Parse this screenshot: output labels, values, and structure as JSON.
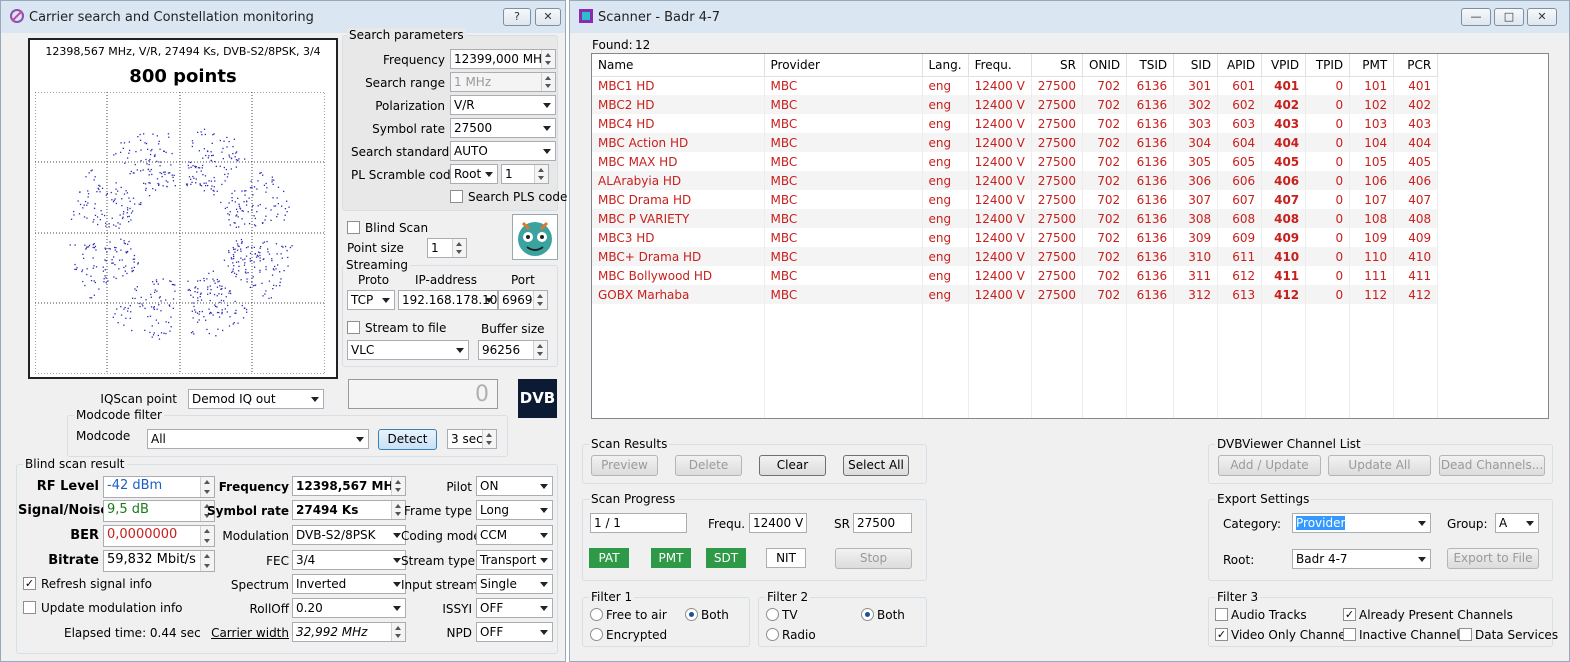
{
  "left": {
    "title": "Carrier search and Constellation monitoring",
    "help_btn": "?",
    "close_btn": "✕",
    "constellation": {
      "info": "12398,567 MHz, V/R, 27494 Ks, DVB-S2/8PSK, 3/4",
      "points_label": "800 points"
    },
    "search_params": {
      "title": "Search parameters",
      "frequency_label": "Frequency",
      "frequency": "12399,000 MHz",
      "search_range_label": "Search range",
      "search_range": "1 MHz",
      "polarization_label": "Polarization",
      "polarization": "V/R",
      "symbol_rate_label": "Symbol rate",
      "symbol_rate": "27500",
      "search_standard_label": "Search standard",
      "search_standard": "AUTO",
      "pl_scramble_label": "PL Scramble code",
      "pl_scramble_mode": "Root",
      "pl_scramble_value": "1",
      "search_pls_label": "Search PLS code"
    },
    "blind_scan_label": "Blind Scan",
    "point_size_label": "Point size",
    "point_size": "1",
    "streaming": {
      "title": "Streaming",
      "proto_label": "Proto",
      "ip_label": "IP-address",
      "port_label": "Port",
      "proto": "TCP",
      "ip": "192.168.178.10",
      "port": "6969",
      "stream_to_file_label": "Stream to file",
      "buffer_size_label": "Buffer size",
      "player": "VLC",
      "buffer_size": "96256"
    },
    "iqscan_label": "IQScan point",
    "iqscan": "Demod IQ out",
    "counter": "0",
    "dvb_logo": "DVB",
    "modcode_filter": {
      "title": "Modcode filter",
      "modcode_label": "Modcode",
      "modcode": "All",
      "detect_btn": "Detect",
      "interval": "3 sec"
    },
    "blind_result": {
      "title": "Blind scan result",
      "rf_level_label": "RF Level",
      "rf_level": "-42 dBm",
      "snr_label": "Signal/Noise",
      "snr": "9,5 dB",
      "ber_label": "BER",
      "ber": "0,0000000",
      "bitrate_label": "Bitrate",
      "bitrate": "59,832 Mbit/s",
      "refresh_label": "Refresh signal info",
      "update_mod_label": "Update modulation info",
      "elapsed": "Elapsed time: 0.44 sec",
      "frequency_label": "Frequency",
      "frequency": "12398,567 MHz",
      "symbol_rate_label": "Symbol rate",
      "symbol_rate": "27494 Ks",
      "modulation_label": "Modulation",
      "modulation": "DVB-S2/8PSK",
      "fec_label": "FEC",
      "fec": "3/4",
      "spectrum_label": "Spectrum",
      "spectrum": "Inverted",
      "rolloff_label": "RollOff",
      "rolloff": "0.20",
      "carrier_width_label": "Carrier width",
      "carrier_width": "32,992 MHz",
      "pilot_label": "Pilot",
      "pilot": "ON",
      "frame_type_label": "Frame type",
      "frame_type": "Long",
      "coding_mode_label": "Coding mode",
      "coding_mode": "CCM",
      "stream_type_label": "Stream type",
      "stream_type": "Transport",
      "input_stream_label": "Input stream",
      "input_stream": "Single",
      "issyi_label": "ISSYI",
      "issyi": "OFF",
      "npd_label": "NPD",
      "npd": "OFF"
    }
  },
  "right": {
    "title": "Scanner - Badr 4-7",
    "found_label": "Found:",
    "found": "12",
    "columns": [
      "Name",
      "Provider",
      "Lang.",
      "Frequ.",
      "SR",
      "ONID",
      "TSID",
      "SID",
      "APID",
      "VPID",
      "TPID",
      "PMT",
      "PCR"
    ],
    "rows": [
      [
        "MBC1 HD",
        "MBC",
        "eng",
        "12400 V",
        "27500",
        "702",
        "6136",
        "301",
        "601",
        "401",
        "0",
        "101",
        "401"
      ],
      [
        "MBC2 HD",
        "MBC",
        "eng",
        "12400 V",
        "27500",
        "702",
        "6136",
        "302",
        "602",
        "402",
        "0",
        "102",
        "402"
      ],
      [
        "MBC4 HD",
        "MBC",
        "eng",
        "12400 V",
        "27500",
        "702",
        "6136",
        "303",
        "603",
        "403",
        "0",
        "103",
        "403"
      ],
      [
        "MBC Action HD",
        "MBC",
        "eng",
        "12400 V",
        "27500",
        "702",
        "6136",
        "304",
        "604",
        "404",
        "0",
        "104",
        "404"
      ],
      [
        "MBC MAX HD",
        "MBC",
        "eng",
        "12400 V",
        "27500",
        "702",
        "6136",
        "305",
        "605",
        "405",
        "0",
        "105",
        "405"
      ],
      [
        "ALArabyia HD",
        "MBC",
        "eng",
        "12400 V",
        "27500",
        "702",
        "6136",
        "306",
        "606",
        "406",
        "0",
        "106",
        "406"
      ],
      [
        "MBC Drama HD",
        "MBC",
        "eng",
        "12400 V",
        "27500",
        "702",
        "6136",
        "307",
        "607",
        "407",
        "0",
        "107",
        "407"
      ],
      [
        "MBC P VARIETY",
        "MBC",
        "eng",
        "12400 V",
        "27500",
        "702",
        "6136",
        "308",
        "608",
        "408",
        "0",
        "108",
        "408"
      ],
      [
        "MBC3 HD",
        "MBC",
        "eng",
        "12400 V",
        "27500",
        "702",
        "6136",
        "309",
        "609",
        "409",
        "0",
        "109",
        "409"
      ],
      [
        "MBC+ Drama HD",
        "MBC",
        "eng",
        "12400 V",
        "27500",
        "702",
        "6136",
        "310",
        "611",
        "410",
        "0",
        "110",
        "410"
      ],
      [
        "MBC Bollywood HD",
        "MBC",
        "eng",
        "12400 V",
        "27500",
        "702",
        "6136",
        "311",
        "612",
        "411",
        "0",
        "111",
        "411"
      ],
      [
        "GOBX Marhaba",
        "MBC",
        "eng",
        "12400 V",
        "27500",
        "702",
        "6136",
        "312",
        "613",
        "412",
        "0",
        "112",
        "412"
      ]
    ],
    "scan_results": {
      "title": "Scan Results",
      "preview": "Preview",
      "delete": "Delete",
      "clear": "Clear",
      "select_all": "Select All"
    },
    "scan_progress": {
      "title": "Scan Progress",
      "progress": "1 / 1",
      "frequ_label": "Frequ.",
      "frequ": "12400 V",
      "sr_label": "SR",
      "sr": "27500",
      "pat": "PAT",
      "pmt": "PMT",
      "sdt": "SDT",
      "nit": "NIT",
      "stop": "Stop"
    },
    "filter1": {
      "title": "Filter 1",
      "fta": "Free to air",
      "both": "Both",
      "encrypted": "Encrypted"
    },
    "filter2": {
      "title": "Filter 2",
      "tv": "TV",
      "both": "Both",
      "radio": "Radio"
    },
    "channel_list": {
      "title": "DVBViewer Channel List",
      "add": "Add / Update",
      "update_all": "Update All",
      "dead": "Dead Channels..."
    },
    "export": {
      "title": "Export Settings",
      "category_label": "Category:",
      "category": "Provider",
      "group_label": "Group:",
      "group": "A",
      "root_label": "Root:",
      "root": "Badr 4-7",
      "export_btn": "Export to File"
    },
    "filter3": {
      "title": "Filter 3",
      "audio": "Audio Tracks",
      "already": "Already Present Channels",
      "video_only": "Video Only Channel",
      "inactive": "Inactive Channels",
      "data": "Data Services"
    },
    "title_buttons": {
      "minimize": "—",
      "maximize": "□",
      "close": "✕"
    }
  }
}
